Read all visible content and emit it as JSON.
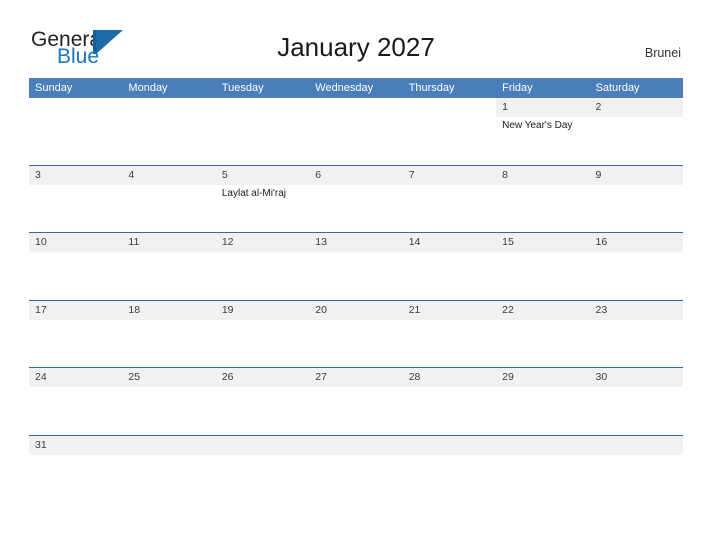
{
  "brand": {
    "word_one": "General",
    "word_two": "Blue",
    "mark": "triangle-logo",
    "accent_color": "#1c75bc"
  },
  "header": {
    "title": "January 2027",
    "country": "Brunei"
  },
  "theme": {
    "header_blue": "#4a7ebb",
    "rule_blue": "#2e6da4",
    "band_gray": "#f1f1f1"
  },
  "calendar": {
    "weekdays": [
      "Sunday",
      "Monday",
      "Tuesday",
      "Wednesday",
      "Thursday",
      "Friday",
      "Saturday"
    ],
    "weeks": [
      [
        {
          "day": "",
          "events": []
        },
        {
          "day": "",
          "events": []
        },
        {
          "day": "",
          "events": []
        },
        {
          "day": "",
          "events": []
        },
        {
          "day": "",
          "events": []
        },
        {
          "day": "1",
          "events": [
            "New Year's Day"
          ]
        },
        {
          "day": "2",
          "events": []
        }
      ],
      [
        {
          "day": "3",
          "events": []
        },
        {
          "day": "4",
          "events": []
        },
        {
          "day": "5",
          "events": [
            "Laylat al-Mi'raj"
          ]
        },
        {
          "day": "6",
          "events": []
        },
        {
          "day": "7",
          "events": []
        },
        {
          "day": "8",
          "events": []
        },
        {
          "day": "9",
          "events": []
        }
      ],
      [
        {
          "day": "10",
          "events": []
        },
        {
          "day": "11",
          "events": []
        },
        {
          "day": "12",
          "events": []
        },
        {
          "day": "13",
          "events": []
        },
        {
          "day": "14",
          "events": []
        },
        {
          "day": "15",
          "events": []
        },
        {
          "day": "16",
          "events": []
        }
      ],
      [
        {
          "day": "17",
          "events": []
        },
        {
          "day": "18",
          "events": []
        },
        {
          "day": "19",
          "events": []
        },
        {
          "day": "20",
          "events": []
        },
        {
          "day": "21",
          "events": []
        },
        {
          "day": "22",
          "events": []
        },
        {
          "day": "23",
          "events": []
        }
      ],
      [
        {
          "day": "24",
          "events": []
        },
        {
          "day": "25",
          "events": []
        },
        {
          "day": "26",
          "events": []
        },
        {
          "day": "27",
          "events": []
        },
        {
          "day": "28",
          "events": []
        },
        {
          "day": "29",
          "events": []
        },
        {
          "day": "30",
          "events": []
        }
      ],
      [
        {
          "day": "31",
          "events": []
        },
        {
          "day": "",
          "events": []
        },
        {
          "day": "",
          "events": []
        },
        {
          "day": "",
          "events": []
        },
        {
          "day": "",
          "events": []
        },
        {
          "day": "",
          "events": []
        },
        {
          "day": "",
          "events": []
        }
      ]
    ]
  }
}
